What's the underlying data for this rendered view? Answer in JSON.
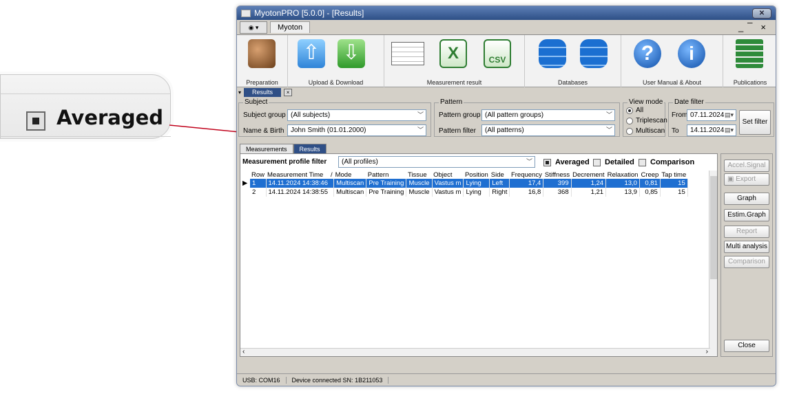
{
  "callout": {
    "label": "Averaged"
  },
  "window": {
    "title": "MyotonPRO [5.0.0] - [Results]",
    "close_glyph": "✕"
  },
  "menubar": {
    "tab": "Myoton",
    "mdi_controls": "_ ̅ ×"
  },
  "ribbon": {
    "groups": [
      "Preparation",
      "Upload & Download",
      "Measurement result",
      "Databases",
      "User Manual & About",
      "Publications"
    ],
    "csv_text": "CSV"
  },
  "doc_tab": {
    "label": "Results",
    "close": "×"
  },
  "subject": {
    "legend": "Subject",
    "group_label": "Subject group",
    "group_value": "(All subjects)",
    "name_label": "Name & Birth",
    "name_value": "John  Smith (01.01.2000)"
  },
  "pattern": {
    "legend": "Pattern",
    "group_label": "Pattern group",
    "group_value": "(All pattern groups)",
    "filter_label": "Pattern filter",
    "filter_value": "(All patterns)"
  },
  "view_mode": {
    "legend": "View mode",
    "options": [
      "All",
      "Triplescan",
      "Multiscan"
    ],
    "selected": "All"
  },
  "date_filter": {
    "legend": "Date filter",
    "from_label": "From",
    "from_value": "07.11.2024",
    "to_label": "To",
    "to_value": "14.11.2024",
    "set_button": "Set filter"
  },
  "content_tabs": [
    "Measurements",
    "Results"
  ],
  "profile_filter": {
    "label": "Measurement profile filter",
    "value": "(All profiles)"
  },
  "view_checks": {
    "averaged": "Averaged",
    "detailed": "Detailed",
    "comparison": "Comparison"
  },
  "table": {
    "columns": [
      "Row",
      "Measurement Time",
      "/",
      "Mode",
      "Pattern",
      "Tissue",
      "Object",
      "Position",
      "Side",
      "Frequency",
      "Stiffness",
      "Decrement",
      "Relaxation",
      "Creep",
      "Tap time"
    ],
    "rows": [
      [
        "1",
        "14.11.2024 14:38:46",
        "Multiscan",
        "Pre Training",
        "Muscle",
        "Vastus m",
        "Lying",
        "Left",
        "17,4",
        "399",
        "1,24",
        "13,0",
        "0,81",
        "15"
      ],
      [
        "2",
        "14.11.2024 14:38:55",
        "Multiscan",
        "Pre Training",
        "Muscle",
        "Vastus m",
        "Lying",
        "Right",
        "16,8",
        "368",
        "1,21",
        "13,9",
        "0,85",
        "15"
      ]
    ]
  },
  "side_buttons": {
    "accel": "Accel.Signal",
    "export": "Export",
    "graph": "Graph",
    "estim_graph": "Estim.Graph",
    "report": "Report",
    "multi": "Multi analysis",
    "comparison": "Comparison",
    "close": "Close"
  },
  "status": {
    "port": "USB: COM16",
    "device": "Device connected SN: 1B211053"
  },
  "colors": {
    "accent": "#2f4f86",
    "selection": "#1f6fd1",
    "arrow": "#c0001a"
  }
}
